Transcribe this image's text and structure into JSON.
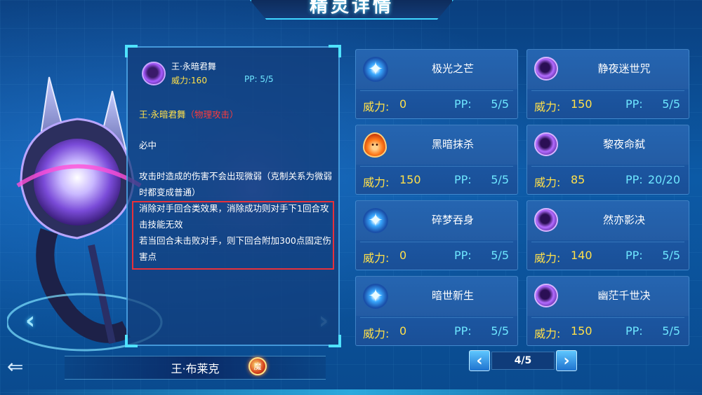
{
  "title": "精灵详情",
  "pet": {
    "name": "王·布莱克",
    "attribute_icon": "shadow-attribute-icon"
  },
  "detail": {
    "skill_name": "王·永暗君舞",
    "power_label": "威力:",
    "power_value": "160",
    "pp_label": "PP:",
    "pp_value": "5/5",
    "name_line": "王·永暗君舞",
    "category": "（物理攻击）",
    "line1": "必中",
    "line2": "攻击时造成的伤害不会出现微弱（克制关系为微弱时都变成普通）",
    "line3": "消除对手回合类效果，消除成功则对手下1回合攻击技能无效",
    "line4": "若当回合未击败对手，则下回合附加300点固定伤害点"
  },
  "skills": [
    {
      "name": "极光之芒",
      "power_label": "威力:",
      "power": "0",
      "pp_label": "PP:",
      "pp": "5/5",
      "icon": "star-icon"
    },
    {
      "name": "静夜迷世咒",
      "power_label": "威力:",
      "power": "150",
      "pp_label": "PP:",
      "pp": "5/5",
      "icon": "shadow-icon"
    },
    {
      "name": "黑暗抹杀",
      "power_label": "威力:",
      "power": "150",
      "pp_label": "PP:",
      "pp": "5/5",
      "icon": "fire-icon"
    },
    {
      "name": "黎夜命弑",
      "power_label": "威力:",
      "power": "85",
      "pp_label": "PP:",
      "pp": "20/20",
      "icon": "shadow-icon"
    },
    {
      "name": "碎梦吞身",
      "power_label": "威力:",
      "power": "0",
      "pp_label": "PP:",
      "pp": "5/5",
      "icon": "star-icon"
    },
    {
      "name": "然亦影决",
      "power_label": "威力:",
      "power": "140",
      "pp_label": "PP:",
      "pp": "5/5",
      "icon": "shadow-icon"
    },
    {
      "name": "暗世新生",
      "power_label": "威力:",
      "power": "0",
      "pp_label": "PP:",
      "pp": "5/5",
      "icon": "star-icon"
    },
    {
      "name": "幽茫千世决",
      "power_label": "威力:",
      "power": "150",
      "pp_label": "PP:",
      "pp": "5/5",
      "icon": "shadow-icon"
    }
  ],
  "pager": {
    "current": "4/5",
    "prev": "‹",
    "next": "›"
  },
  "nav": {
    "back": "⇐",
    "left": "‹",
    "right": "›"
  },
  "badge_text": "魔"
}
